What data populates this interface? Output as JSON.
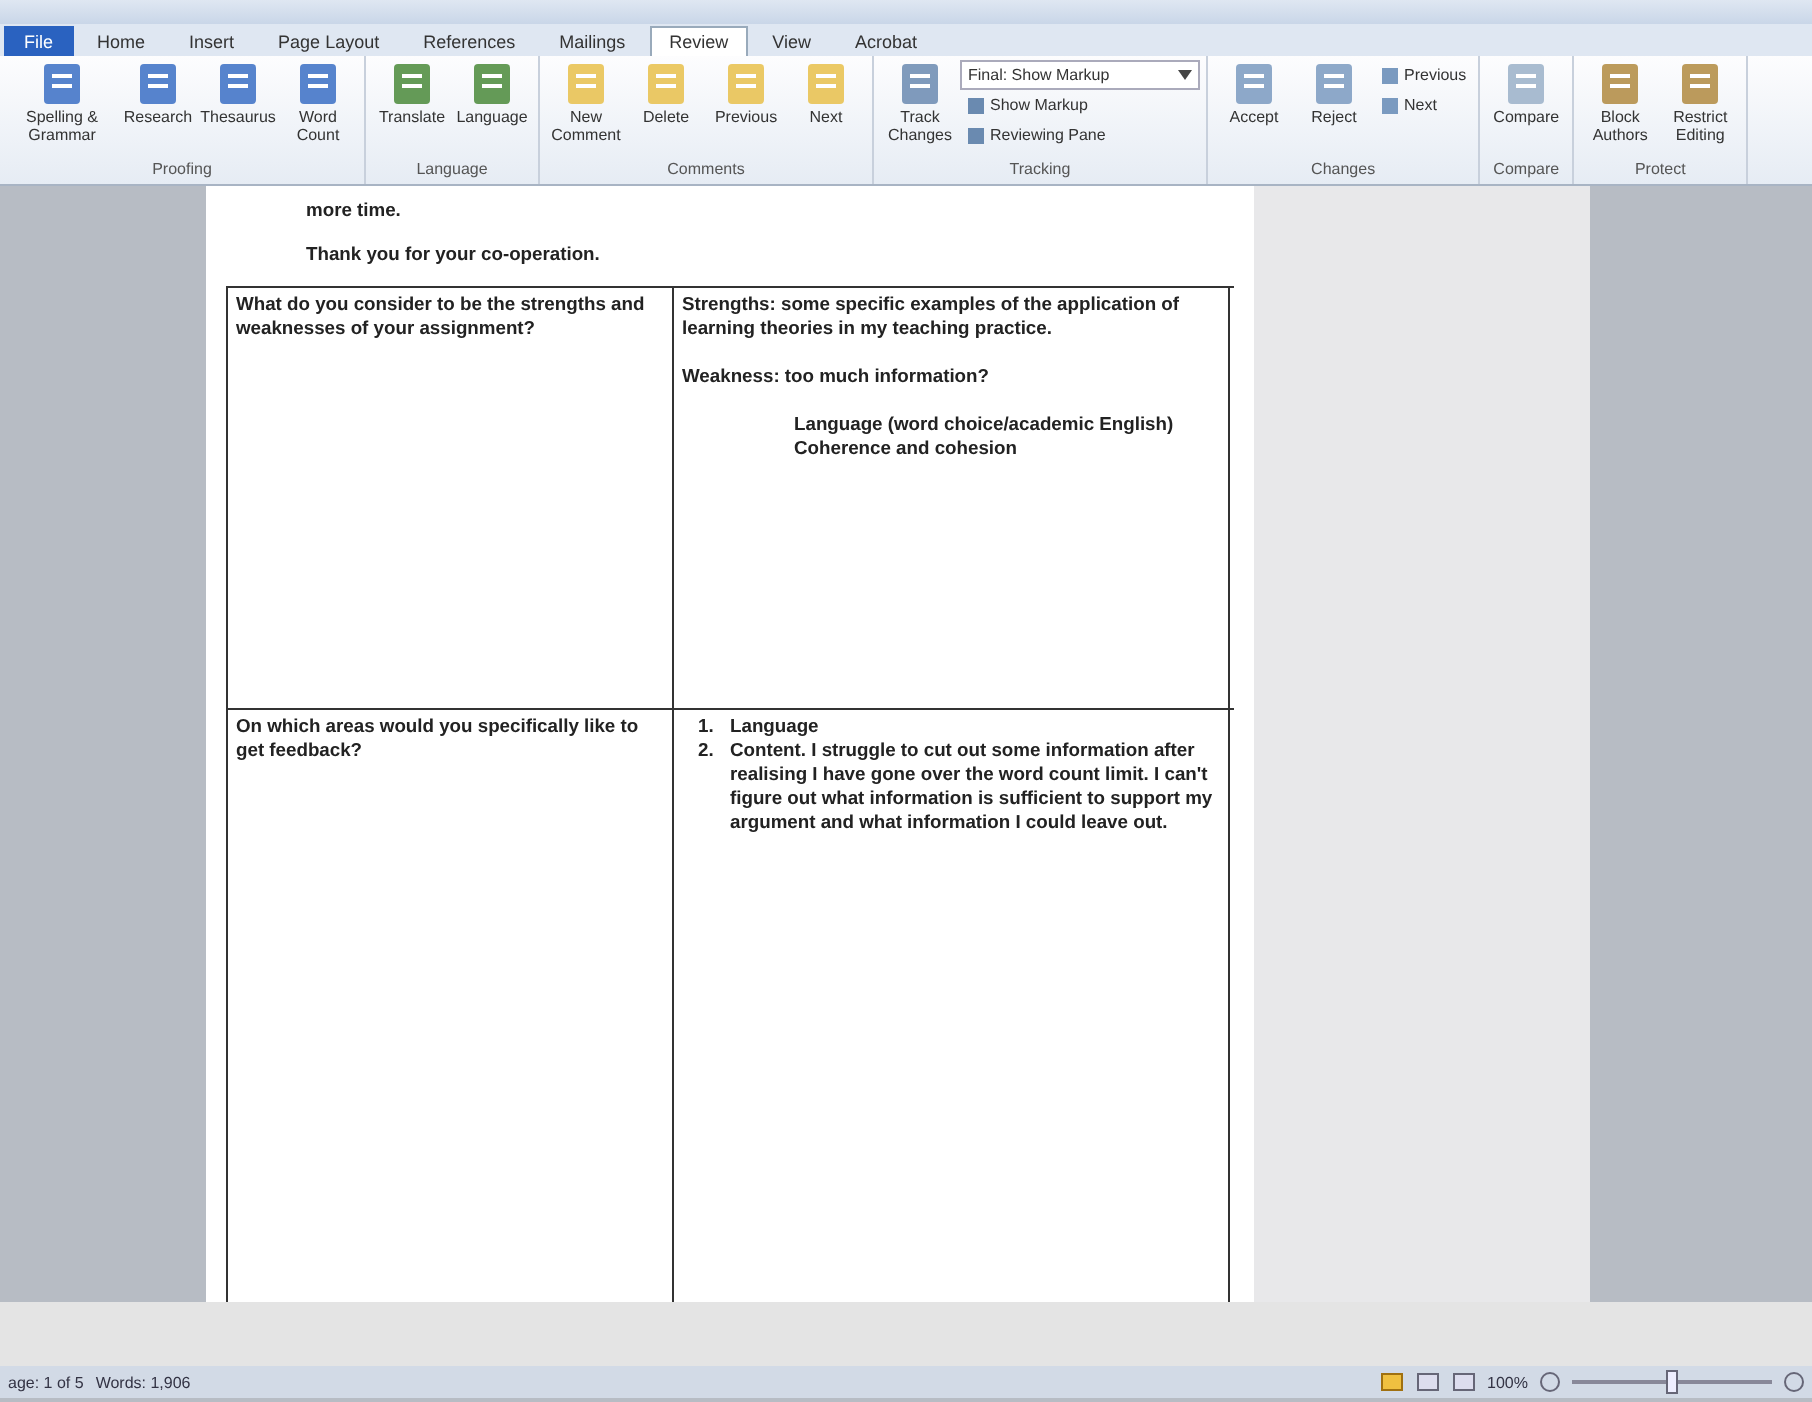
{
  "tabs": [
    {
      "label": "File",
      "selected": false,
      "kind": "file"
    },
    {
      "label": "Home",
      "selected": false,
      "kind": "tab"
    },
    {
      "label": "Insert",
      "selected": false,
      "kind": "tab"
    },
    {
      "label": "Page Layout",
      "selected": false,
      "kind": "tab"
    },
    {
      "label": "References",
      "selected": false,
      "kind": "tab"
    },
    {
      "label": "Mailings",
      "selected": false,
      "kind": "tab"
    },
    {
      "label": "Review",
      "selected": true,
      "kind": "tab"
    },
    {
      "label": "View",
      "selected": false,
      "kind": "tab"
    },
    {
      "label": "Acrobat",
      "selected": false,
      "kind": "tab"
    }
  ],
  "ribbon_groups": [
    {
      "name": "Proofing",
      "buttons": [
        {
          "label": "Spelling & Grammar",
          "kind": "large"
        },
        {
          "label": "Research",
          "kind": "large"
        },
        {
          "label": "Thesaurus",
          "kind": "large"
        },
        {
          "label": "Word Count",
          "kind": "large"
        }
      ]
    },
    {
      "name": "Language",
      "buttons": [
        {
          "label": "Translate",
          "kind": "large"
        },
        {
          "label": "Language",
          "kind": "large"
        }
      ]
    },
    {
      "name": "Comments",
      "buttons": [
        {
          "label": "New Comment",
          "kind": "large"
        },
        {
          "label": "Delete",
          "kind": "large"
        },
        {
          "label": "Previous",
          "kind": "large"
        },
        {
          "label": "Next",
          "kind": "large"
        }
      ]
    },
    {
      "name": "Tracking",
      "buttons": [
        {
          "label": "Track Changes",
          "kind": "large"
        },
        {
          "label": "Final: Show Markup",
          "kind": "dropdown"
        },
        {
          "label": "Show Markup",
          "kind": "small"
        },
        {
          "label": "Reviewing Pane",
          "kind": "small"
        }
      ]
    },
    {
      "name": "Changes",
      "buttons": [
        {
          "label": "Accept",
          "kind": "large"
        },
        {
          "label": "Reject",
          "kind": "large"
        },
        {
          "label": "Previous",
          "kind": "small"
        },
        {
          "label": "Next",
          "kind": "small"
        }
      ]
    },
    {
      "name": "Compare",
      "buttons": [
        {
          "label": "Compare",
          "kind": "large"
        }
      ]
    },
    {
      "name": "Protect",
      "buttons": [
        {
          "label": "Block Authors",
          "kind": "large"
        },
        {
          "label": "Restrict Editing",
          "kind": "large"
        }
      ]
    }
  ],
  "document": {
    "paragraphs": [
      "more time.",
      "Thank you for your co-operation."
    ],
    "table": {
      "rows": [
        {
          "question": "What do you consider to be the strengths and weaknesses of your assignment?",
          "answer": [
            {
              "kind": "para",
              "text": "Strengths: some specific examples of the application of learning theories in my teaching practice."
            },
            {
              "kind": "para",
              "text": "Weakness: too much information?"
            },
            {
              "kind": "indent",
              "text": "Language (word choice/academic English)"
            },
            {
              "kind": "indent",
              "text": "Coherence and cohesion"
            }
          ]
        },
        {
          "question": "On which areas would you specifically like to get feedback?",
          "answer": [
            {
              "kind": "item",
              "number": "1.",
              "text": "Language"
            },
            {
              "kind": "item",
              "number": "2.",
              "text": "Content. I struggle to cut out some information after realising I have gone over the word count limit. I can't figure out what information is sufficient to support my argument and what information I could leave out."
            }
          ]
        }
      ]
    }
  },
  "status_bar": {
    "page": "age: 1 of 5",
    "words": "Words: 1,906",
    "zoom": "100%",
    "zoom_slider": {
      "level": 0.5
    }
  }
}
